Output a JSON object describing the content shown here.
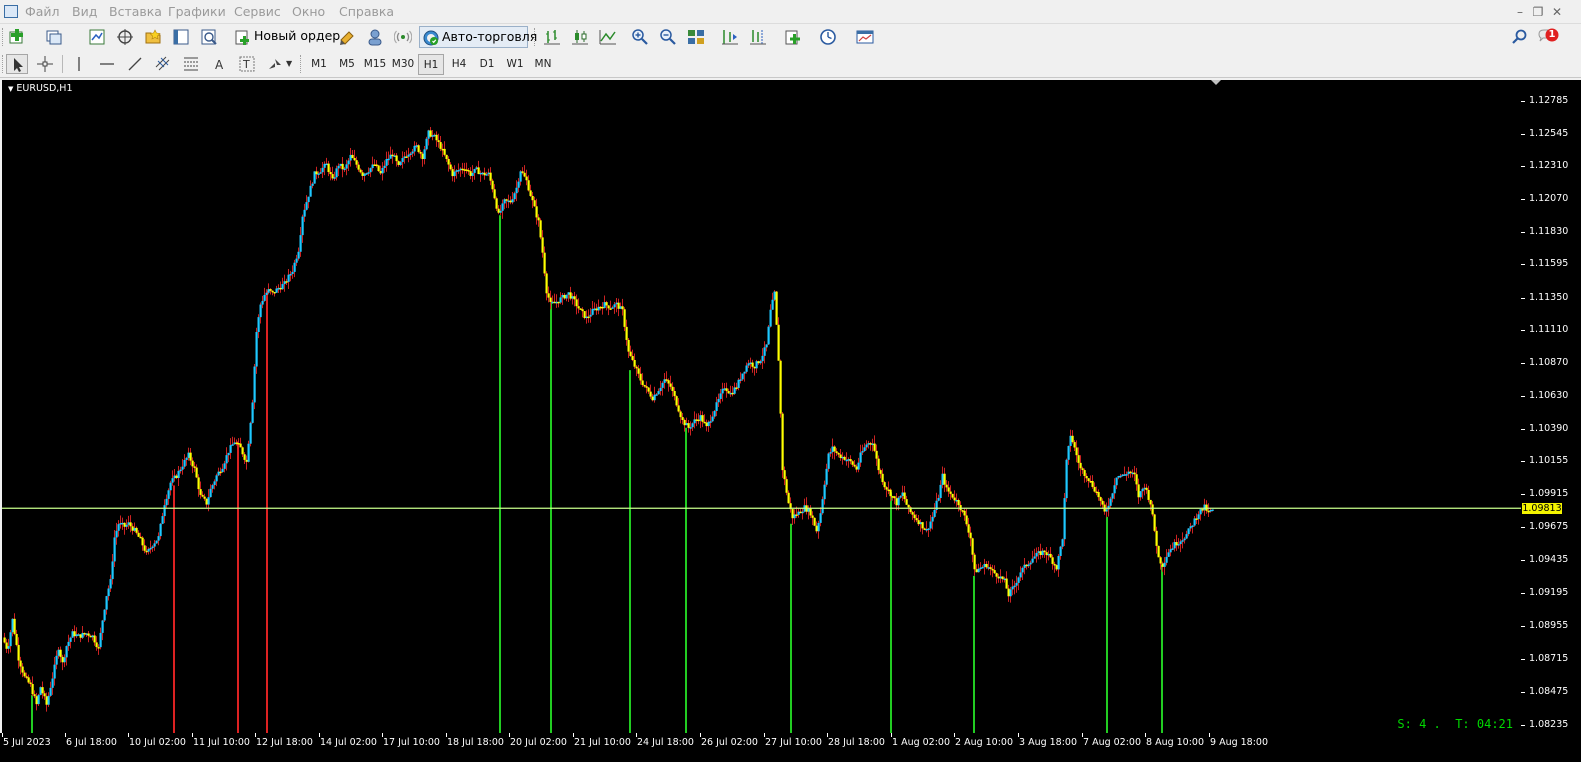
{
  "menu": {
    "items": [
      "Файл",
      "Вид",
      "Вставка",
      "Графики",
      "Сервис",
      "Окно",
      "Справка"
    ]
  },
  "toolbar": {
    "new_order_label": "Новый ордер",
    "autotrading_label": "Авто-торговля",
    "notification_count": "1"
  },
  "timeframes": [
    "M1",
    "M5",
    "M15",
    "M30",
    "H1",
    "H4",
    "D1",
    "W1",
    "MN"
  ],
  "active_timeframe": "H1",
  "chart": {
    "title": "EURUSD,H1",
    "current_price": "1.09813",
    "timer_text": "S: 4 .  T: 04:21",
    "colors": {
      "background": "#000000",
      "bull_candle": "#1ec8ff",
      "bear_candle": "#ffff00",
      "wick": "#cc2222",
      "buy_signal": "#22cc22",
      "sell_signal": "#dd2222",
      "price_line": "#c8ff8c"
    }
  },
  "chart_data": {
    "type": "candlestick",
    "symbol": "EURUSD",
    "timeframe": "H1",
    "ylim": [
      1.0821,
      1.129
    ],
    "price_ticks": [
      "1.12785",
      "1.12545",
      "1.12310",
      "1.12070",
      "1.11830",
      "1.11595",
      "1.11350",
      "1.11110",
      "1.10870",
      "1.10630",
      "1.10390",
      "1.10155",
      "1.09915",
      "1.09675",
      "1.09435",
      "1.09195",
      "1.08955",
      "1.08715",
      "1.08475",
      "1.08235"
    ],
    "time_ticks": [
      "5 Jul 2023",
      "6 Jul 18:00",
      "10 Jul 02:00",
      "11 Jul 10:00",
      "12 Jul 18:00",
      "14 Jul 02:00",
      "17 Jul 10:00",
      "18 Jul 18:00",
      "20 Jul 02:00",
      "21 Jul 10:00",
      "24 Jul 18:00",
      "26 Jul 02:00",
      "27 Jul 10:00",
      "28 Jul 18:00",
      "1 Aug 02:00",
      "2 Aug 10:00",
      "3 Aug 18:00",
      "7 Aug 02:00",
      "8 Aug 10:00",
      "9 Aug 18:00"
    ],
    "current_price": 1.09813,
    "price_path": [
      [
        0,
        1.0887
      ],
      [
        5,
        1.0878
      ],
      [
        10,
        1.09
      ],
      [
        16,
        1.0872
      ],
      [
        22,
        1.0858
      ],
      [
        28,
        1.0852
      ],
      [
        34,
        1.0838
      ],
      [
        38,
        1.0851
      ],
      [
        44,
        1.0838
      ],
      [
        50,
        1.0858
      ],
      [
        56,
        1.088
      ],
      [
        60,
        1.0868
      ],
      [
        64,
        1.0881
      ],
      [
        70,
        1.089
      ],
      [
        76,
        1.0888
      ],
      [
        84,
        1.089
      ],
      [
        90,
        1.0888
      ],
      [
        96,
        1.0879
      ],
      [
        100,
        1.09
      ],
      [
        104,
        1.0918
      ],
      [
        108,
        1.0928
      ],
      [
        112,
        1.096
      ],
      [
        116,
        1.097
      ],
      [
        122,
        1.0968
      ],
      [
        126,
        1.097
      ],
      [
        132,
        1.0965
      ],
      [
        138,
        1.0958
      ],
      [
        144,
        1.0948
      ],
      [
        150,
        1.0955
      ],
      [
        156,
        1.096
      ],
      [
        162,
        1.0985
      ],
      [
        168,
        1.1
      ],
      [
        174,
        1.1005
      ],
      [
        180,
        1.1013
      ],
      [
        186,
        1.102
      ],
      [
        192,
        1.101
      ],
      [
        198,
        1.099
      ],
      [
        204,
        1.0985
      ],
      [
        208,
        1.0995
      ],
      [
        214,
        1.1005
      ],
      [
        220,
        1.1012
      ],
      [
        226,
        1.1023
      ],
      [
        232,
        1.103
      ],
      [
        238,
        1.1025
      ],
      [
        244,
        1.1015
      ],
      [
        250,
        1.106
      ],
      [
        254,
        1.111
      ],
      [
        258,
        1.113
      ],
      [
        262,
        1.1137
      ],
      [
        266,
        1.114
      ],
      [
        270,
        1.1138
      ],
      [
        276,
        1.1142
      ],
      [
        282,
        1.1145
      ],
      [
        286,
        1.115
      ],
      [
        290,
        1.1155
      ],
      [
        296,
        1.117
      ],
      [
        300,
        1.1195
      ],
      [
        306,
        1.121
      ],
      [
        312,
        1.1225
      ],
      [
        318,
        1.1228
      ],
      [
        324,
        1.1232
      ],
      [
        330,
        1.122
      ],
      [
        336,
        1.1232
      ],
      [
        342,
        1.1228
      ],
      [
        348,
        1.1238
      ],
      [
        354,
        1.1232
      ],
      [
        360,
        1.1225
      ],
      [
        366,
        1.1228
      ],
      [
        372,
        1.1232
      ],
      [
        378,
        1.1225
      ],
      [
        384,
        1.1235
      ],
      [
        390,
        1.124
      ],
      [
        396,
        1.123
      ],
      [
        402,
        1.1238
      ],
      [
        408,
        1.1242
      ],
      [
        414,
        1.1245
      ],
      [
        420,
        1.1238
      ],
      [
        426,
        1.1255
      ],
      [
        432,
        1.1252
      ],
      [
        438,
        1.1245
      ],
      [
        444,
        1.1235
      ],
      [
        450,
        1.1225
      ],
      [
        456,
        1.1228
      ],
      [
        462,
        1.123
      ],
      [
        468,
        1.1225
      ],
      [
        474,
        1.1228
      ],
      [
        480,
        1.1225
      ],
      [
        486,
        1.1225
      ],
      [
        490,
        1.1215
      ],
      [
        496,
        1.1195
      ],
      [
        502,
        1.1205
      ],
      [
        508,
        1.1205
      ],
      [
        514,
        1.1215
      ],
      [
        518,
        1.1228
      ],
      [
        524,
        1.122
      ],
      [
        530,
        1.1205
      ],
      [
        536,
        1.119
      ],
      [
        540,
        1.1168
      ],
      [
        544,
        1.114
      ],
      [
        548,
        1.113
      ],
      [
        554,
        1.1132
      ],
      [
        560,
        1.1135
      ],
      [
        566,
        1.1138
      ],
      [
        572,
        1.1132
      ],
      [
        578,
        1.1125
      ],
      [
        584,
        1.112
      ],
      [
        590,
        1.1125
      ],
      [
        596,
        1.1128
      ],
      [
        602,
        1.113
      ],
      [
        608,
        1.1128
      ],
      [
        614,
        1.113
      ],
      [
        620,
        1.1125
      ],
      [
        626,
        1.1095
      ],
      [
        632,
        1.1085
      ],
      [
        638,
        1.1075
      ],
      [
        644,
        1.1068
      ],
      [
        650,
        1.1062
      ],
      [
        656,
        1.1068
      ],
      [
        662,
        1.1075
      ],
      [
        668,
        1.107
      ],
      [
        674,
        1.1058
      ],
      [
        680,
        1.1045
      ],
      [
        686,
        1.104
      ],
      [
        692,
        1.1045
      ],
      [
        698,
        1.1048
      ],
      [
        704,
        1.104
      ],
      [
        710,
        1.105
      ],
      [
        716,
        1.106
      ],
      [
        722,
        1.107
      ],
      [
        728,
        1.1065
      ],
      [
        734,
        1.107
      ],
      [
        740,
        1.108
      ],
      [
        746,
        1.1088
      ],
      [
        752,
        1.1085
      ],
      [
        758,
        1.109
      ],
      [
        764,
        1.11
      ],
      [
        768,
        1.1125
      ],
      [
        772,
        1.1138
      ],
      [
        776,
        1.109
      ],
      [
        780,
        1.101
      ],
      [
        786,
        1.0985
      ],
      [
        790,
        1.0975
      ],
      [
        796,
        1.0978
      ],
      [
        802,
        1.0982
      ],
      [
        808,
        1.0978
      ],
      [
        814,
        1.0965
      ],
      [
        818,
        1.0978
      ],
      [
        822,
        1.1
      ],
      [
        826,
        1.102
      ],
      [
        830,
        1.1025
      ],
      [
        836,
        1.102
      ],
      [
        842,
        1.1018
      ],
      [
        848,
        1.1015
      ],
      [
        854,
        1.101
      ],
      [
        858,
        1.102
      ],
      [
        864,
        1.1028
      ],
      [
        870,
        1.103
      ],
      [
        876,
        1.101
      ],
      [
        882,
        1.0998
      ],
      [
        888,
        1.0992
      ],
      [
        894,
        1.0985
      ],
      [
        900,
        1.0992
      ],
      [
        906,
        1.098
      ],
      [
        912,
        1.0975
      ],
      [
        918,
        1.097
      ],
      [
        924,
        1.0965
      ],
      [
        930,
        1.0975
      ],
      [
        936,
        1.099
      ],
      [
        940,
        1.1005
      ],
      [
        944,
        1.0995
      ],
      [
        950,
        1.099
      ],
      [
        956,
        1.0985
      ],
      [
        962,
        1.0975
      ],
      [
        968,
        1.096
      ],
      [
        972,
        1.0935
      ],
      [
        978,
        1.0938
      ],
      [
        984,
        1.094
      ],
      [
        990,
        1.0935
      ],
      [
        996,
        1.0932
      ],
      [
        1002,
        1.0928
      ],
      [
        1006,
        1.0918
      ],
      [
        1012,
        1.0925
      ],
      [
        1018,
        1.0935
      ],
      [
        1024,
        1.094
      ],
      [
        1030,
        1.0945
      ],
      [
        1036,
        1.0948
      ],
      [
        1042,
        1.095
      ],
      [
        1048,
        1.0945
      ],
      [
        1054,
        1.0938
      ],
      [
        1060,
        1.096
      ],
      [
        1064,
        1.1015
      ],
      [
        1068,
        1.1035
      ],
      [
        1072,
        1.1025
      ],
      [
        1078,
        1.101
      ],
      [
        1084,
        1.1005
      ],
      [
        1090,
        1.0998
      ],
      [
        1096,
        1.099
      ],
      [
        1102,
        1.0978
      ],
      [
        1108,
        1.0988
      ],
      [
        1114,
        1.1005
      ],
      [
        1120,
        1.1005
      ],
      [
        1126,
        1.1008
      ],
      [
        1132,
        1.1005
      ],
      [
        1136,
        1.099
      ],
      [
        1142,
        1.0998
      ],
      [
        1148,
        1.0985
      ],
      [
        1152,
        1.0965
      ],
      [
        1156,
        1.0945
      ],
      [
        1160,
        1.094
      ],
      [
        1166,
        1.095
      ],
      [
        1172,
        1.0955
      ],
      [
        1178,
        1.0958
      ],
      [
        1184,
        1.0962
      ],
      [
        1190,
        1.097
      ],
      [
        1196,
        1.0978
      ],
      [
        1202,
        1.0982
      ],
      [
        1206,
        1.0978
      ],
      [
        1210,
        1.098
      ]
    ],
    "buy_signal_prices": [
      [
        30,
        1.0845
      ],
      [
        498,
        1.1195
      ],
      [
        549,
        1.1132
      ],
      [
        628,
        1.1082
      ],
      [
        684,
        1.104
      ],
      [
        789,
        1.097
      ],
      [
        889,
        1.0993
      ],
      [
        972,
        1.0932
      ],
      [
        1105,
        1.0975
      ],
      [
        1160,
        1.094
      ]
    ],
    "sell_signal_prices": [
      [
        172,
        1.0998
      ],
      [
        236,
        1.103
      ],
      [
        265,
        1.114
      ]
    ]
  }
}
